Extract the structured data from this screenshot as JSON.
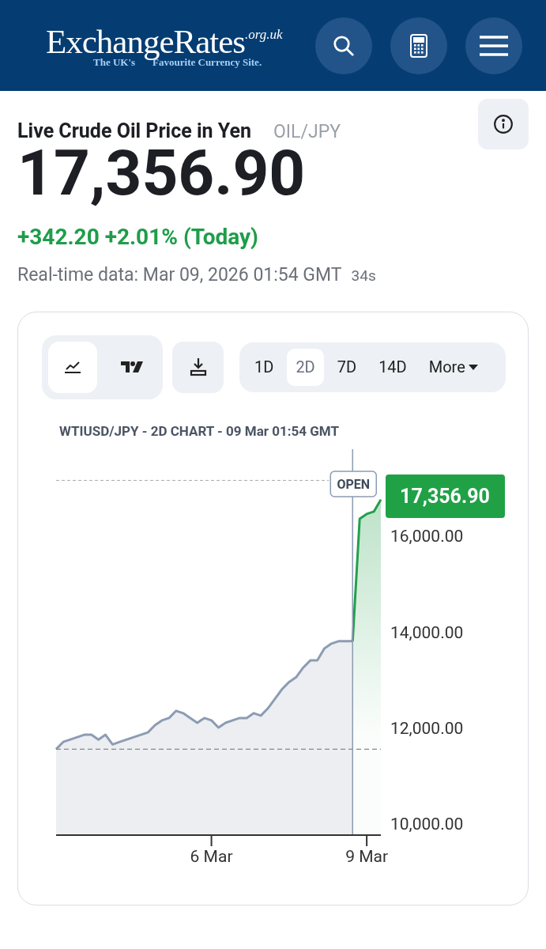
{
  "header": {
    "logo": {
      "name": "ExchangeRates",
      "domain": ".org.uk",
      "tagline_left": "The UK's",
      "tagline_right": "Favourite Currency Site."
    }
  },
  "title": "Live Crude Oil Price in Yen",
  "pair": "OIL/JPY",
  "price": "17,356.90",
  "change": "+342.20 +2.01% (Today)",
  "updated": "Real-time data: Mar 09, 2026 01:54 GMT",
  "age": "34s",
  "chart_type_buttons": [
    {
      "kind": "line",
      "selected": true
    },
    {
      "kind": "candles",
      "selected": false
    }
  ],
  "periods": [
    {
      "label": "1D",
      "selected": false
    },
    {
      "label": "2D",
      "selected": true
    },
    {
      "label": "7D",
      "selected": false
    },
    {
      "label": "14D",
      "selected": false
    },
    {
      "label": "More",
      "selected": false,
      "kind": "dropdown"
    }
  ],
  "chart": {
    "caption": "WTIUSD/JPY - 2D CHART - 09 Mar 01:54 GMT",
    "open_tag": "OPEN",
    "price_tag": "17,356.90",
    "chart_data": {
      "type": "area",
      "categories": [
        null,
        null,
        null,
        null,
        null,
        null,
        null,
        null,
        null,
        null,
        null,
        null,
        null,
        null,
        null,
        null,
        null,
        null,
        null,
        null,
        null,
        null,
        "6 Mar",
        null,
        null,
        null,
        null,
        null,
        null,
        null,
        null,
        null,
        null,
        null,
        null,
        null,
        null,
        null,
        null,
        null,
        null,
        null,
        null,
        null,
        "9 Mar",
        null,
        null
      ],
      "series": [
        {
          "color": "#8d9cb2",
          "values": [
            11550,
            11700,
            11750,
            11800,
            11850,
            11850,
            11750,
            11850,
            11650,
            11700,
            11750,
            11800,
            11850,
            11900,
            12050,
            12150,
            12200,
            12350,
            12300,
            12200,
            12100,
            12200,
            12150,
            12000,
            12100,
            12150,
            12200,
            12200,
            12300,
            12250,
            12400,
            12600,
            12800,
            12950,
            13050,
            13250,
            13400,
            13400,
            13650,
            13750,
            13800,
            13800,
            13800,
            null,
            null,
            null,
            null
          ]
        },
        {
          "color": "#22a04b",
          "values": [
            null,
            null,
            null,
            null,
            null,
            null,
            null,
            null,
            null,
            null,
            null,
            null,
            null,
            null,
            null,
            null,
            null,
            null,
            null,
            null,
            null,
            null,
            null,
            null,
            null,
            null,
            null,
            null,
            null,
            null,
            null,
            null,
            null,
            null,
            null,
            null,
            null,
            null,
            null,
            null,
            null,
            null,
            13800,
            16350,
            16450,
            16500,
            16750
          ]
        }
      ],
      "ylim": [
        9760,
        17800
      ],
      "yticks": [
        {
          "value": 10000,
          "label": "10,000.00"
        },
        {
          "value": 12000,
          "label": "12,000.00"
        },
        {
          "value": 14000,
          "label": "14,000.00"
        },
        {
          "value": 16000,
          "label": "16,000.00"
        }
      ],
      "ref_lines": [
        {
          "axis": "y",
          "value": 17150
        },
        {
          "axis": "y",
          "value": 11550
        }
      ]
    }
  }
}
